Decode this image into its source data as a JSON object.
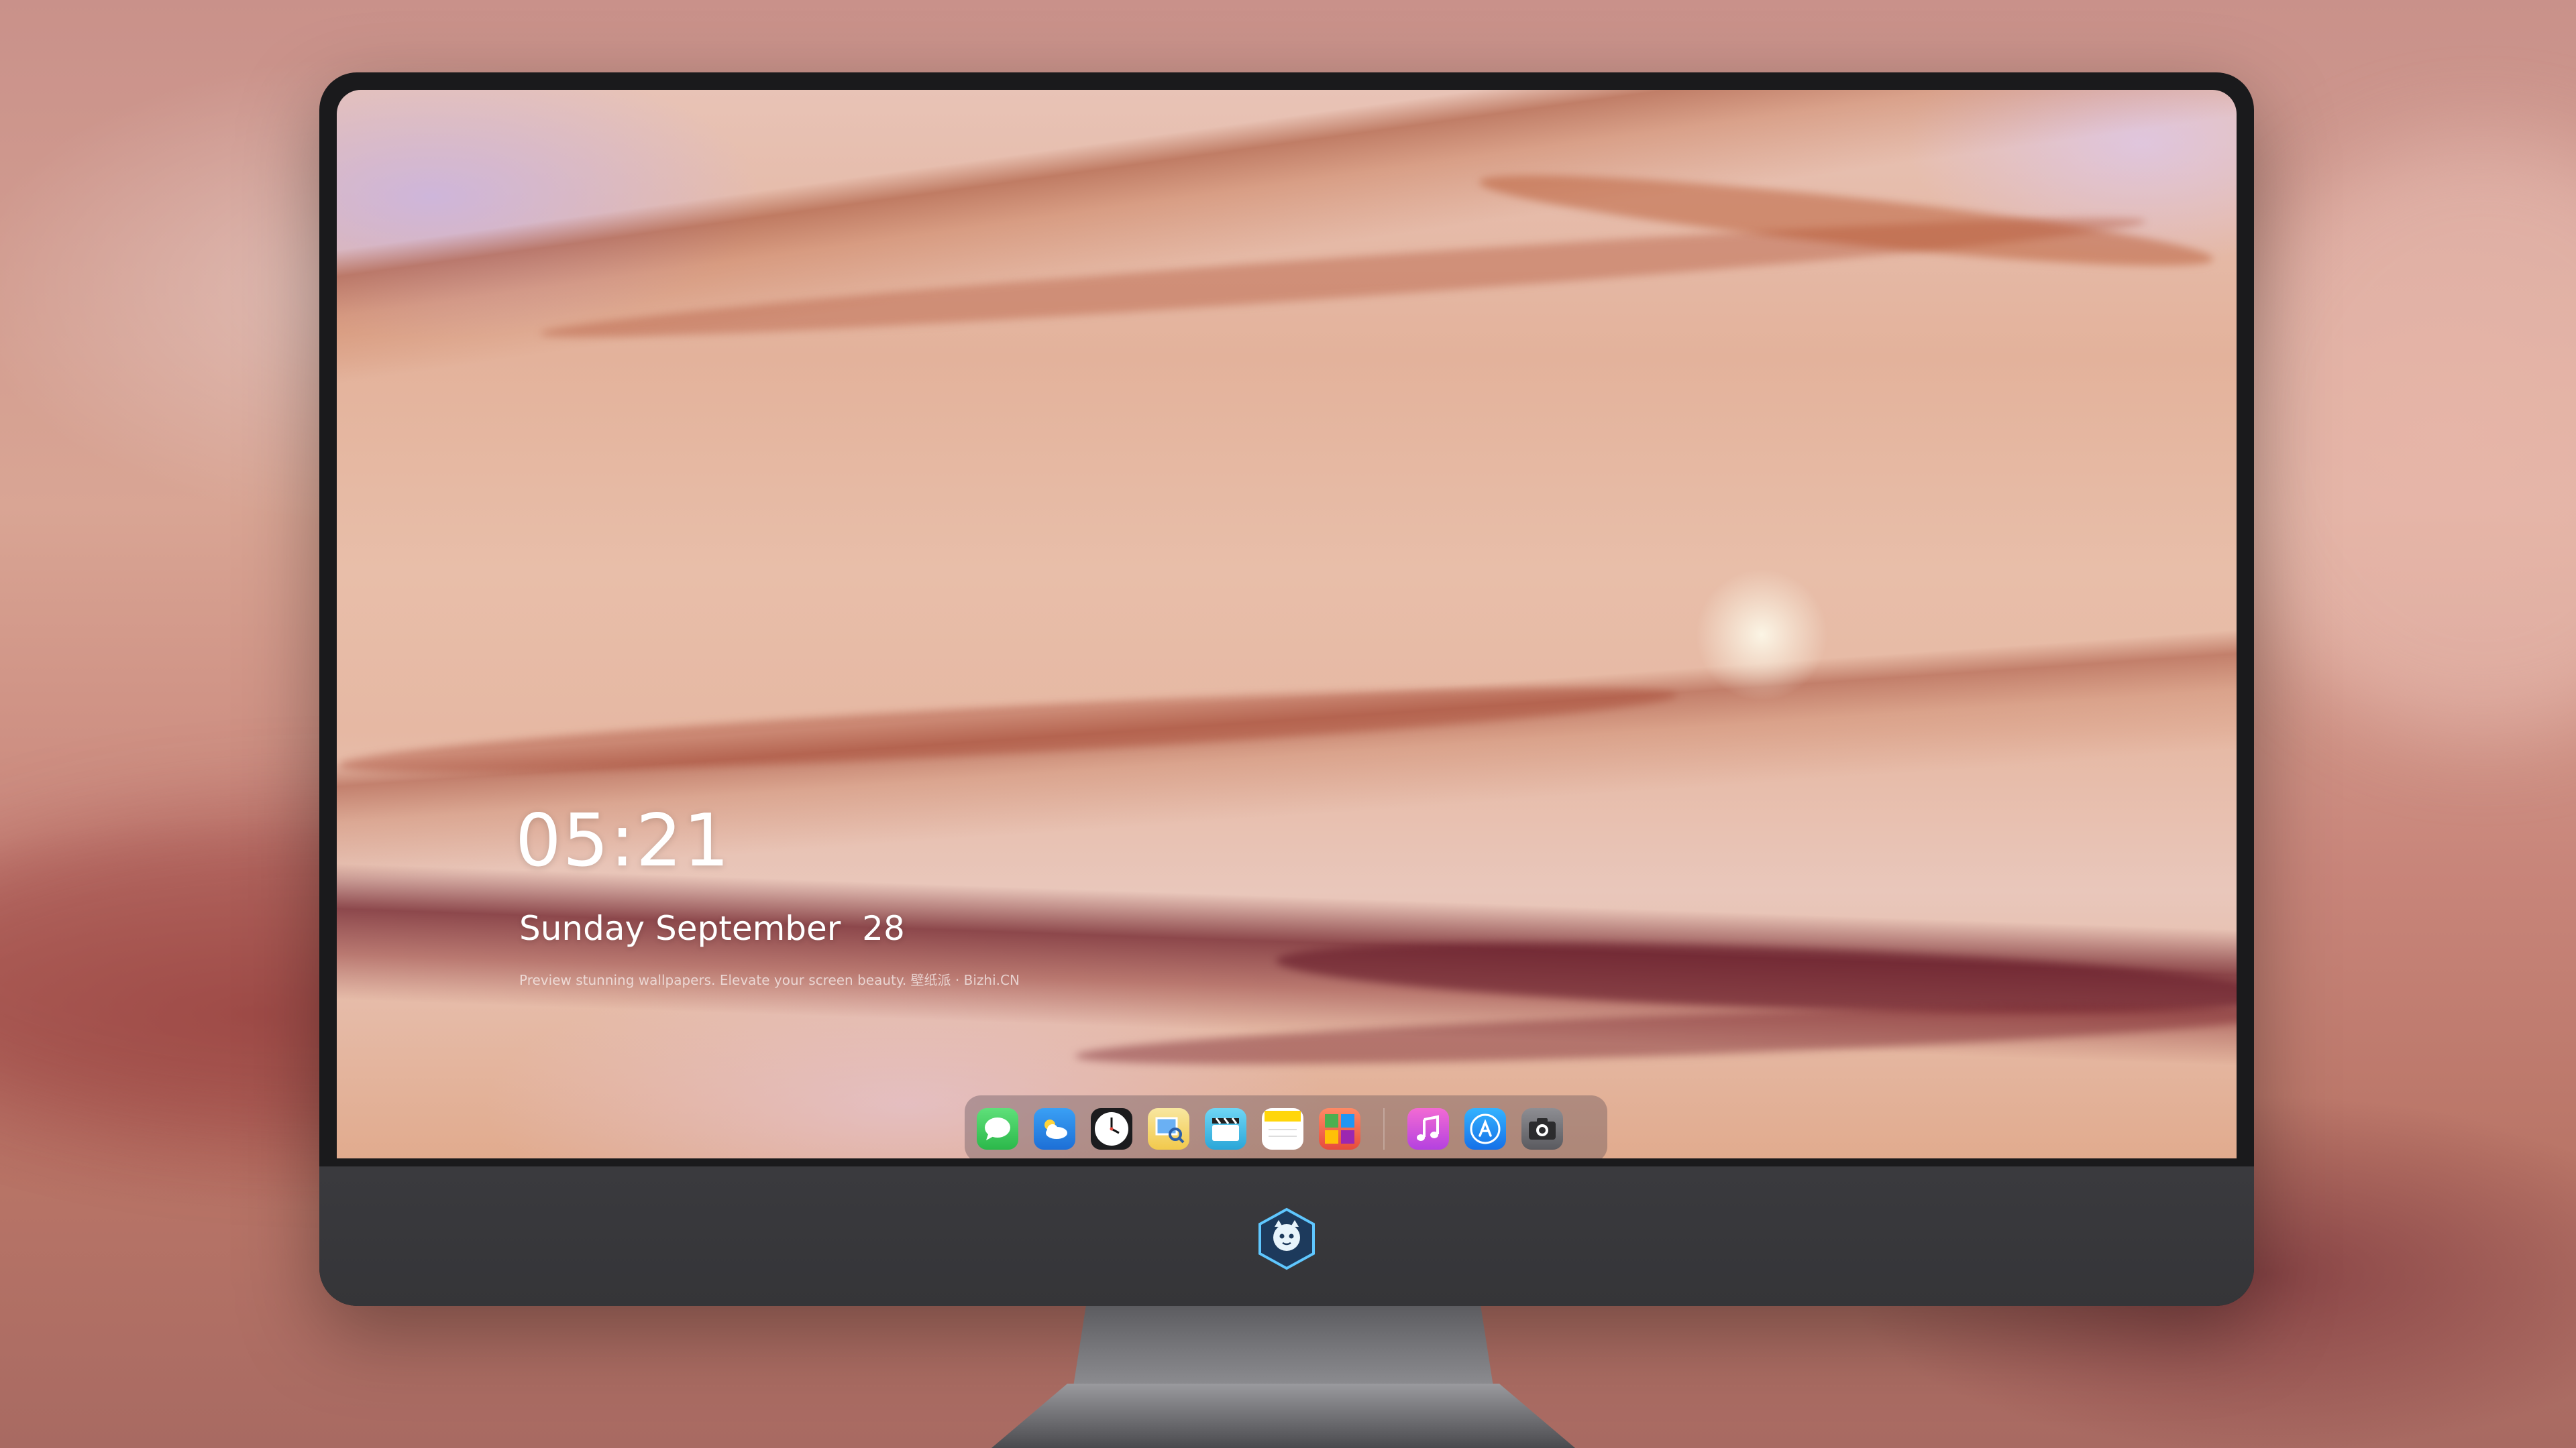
{
  "lock_screen": {
    "time": "05:21",
    "date": "Sunday September  28",
    "tagline": "Preview stunning wallpapers. Elevate your screen beauty. 壁纸派 · Bizhi.CN"
  },
  "dock": {
    "apps": [
      {
        "name": "Messages",
        "icon": "messages-icon",
        "color": "#34c759"
      },
      {
        "name": "Weather",
        "icon": "weather-icon",
        "color": "#2f8fe8"
      },
      {
        "name": "Clock",
        "icon": "clock-icon",
        "color": "#1c1c1e"
      },
      {
        "name": "Preview",
        "icon": "preview-icon",
        "color": "#f5c542"
      },
      {
        "name": "Clips",
        "icon": "clips-icon",
        "color": "#4cc3e8"
      },
      {
        "name": "Notes",
        "icon": "notes-icon",
        "color": "#ffd60a"
      },
      {
        "name": "Photo Booth",
        "icon": "photo-booth-icon",
        "color": "#e74c3c"
      },
      {
        "name": "Music",
        "icon": "music-icon",
        "color": "#d65ce0"
      },
      {
        "name": "App Store",
        "icon": "app-store-icon",
        "color": "#1a8cff"
      },
      {
        "name": "Camera",
        "icon": "camera-icon",
        "color": "#6e6e73"
      }
    ]
  },
  "monitor": {
    "chin_logo": "mascot-logo-icon",
    "accent": "#3a3a3e"
  }
}
